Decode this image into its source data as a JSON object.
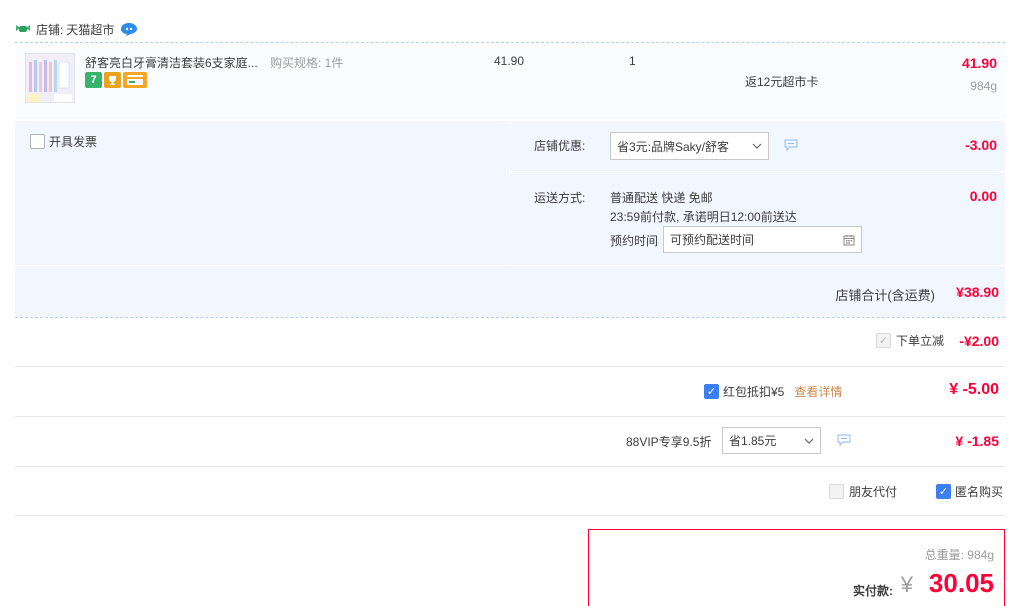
{
  "shop": {
    "label": "店铺:",
    "name": "天猫超市"
  },
  "item": {
    "title": "舒客亮白牙膏清洁套装6支家庭...",
    "spec": "购买规格: 1件",
    "price": "41.90",
    "qty": "1",
    "rebate": "返12元超市卡",
    "total": "41.90",
    "weight": "984g",
    "badges": [
      "7",
      "cup-icon",
      "card-icon"
    ]
  },
  "invoice": {
    "label": "开具发票",
    "checked": false
  },
  "shop_discount": {
    "label": "店铺优惠:",
    "selected": "省3元:品牌Saky/舒客",
    "value": "-3.00"
  },
  "shipping": {
    "label": "运送方式:",
    "line1": "普通配送 快递 免邮",
    "line2": "23:59前付款, 承诺明日12:00前送达",
    "appt_label": "预约时间",
    "appt_value": "可预约配送时间",
    "value": "0.00"
  },
  "shop_total": {
    "label": "店铺合计(含运费)",
    "value": "¥38.90"
  },
  "order_discount": {
    "label": "下单立减",
    "value": "-¥2.00"
  },
  "red_packet": {
    "label": "红包抵扣¥5",
    "details_link": "查看详情",
    "value": "¥ -5.00",
    "checked": true
  },
  "vip": {
    "label": "88VIP专享9.5折",
    "selected": "省1.85元",
    "value": "¥ -1.85"
  },
  "friend_pay": {
    "label": "朋友代付",
    "checked": false
  },
  "anonymous": {
    "label": "匿名购买",
    "checked": true
  },
  "summary": {
    "total_weight": "总重量: 984g",
    "pay_label": "实付款:",
    "currency": "¥",
    "pay_value": "30.05"
  },
  "colors": {
    "accent_red": "#ff0036",
    "panel_blue": "#f2f7ff",
    "check_blue": "#3b7ff3"
  }
}
